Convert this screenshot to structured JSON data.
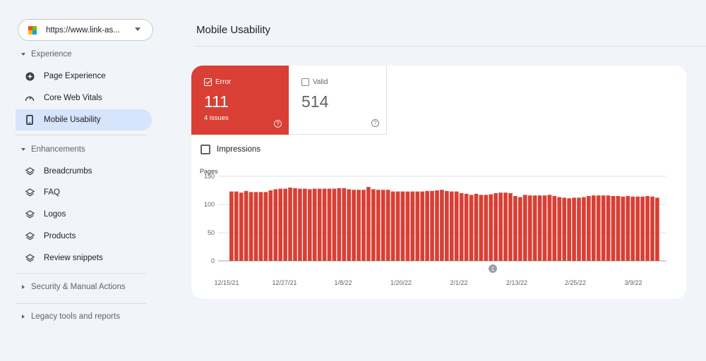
{
  "property": {
    "url": "https://www.link-as...",
    "icon": "microsoft-logo-icon"
  },
  "sidebar": {
    "experience_label": "Experience",
    "experience_items": [
      {
        "label": "Page Experience",
        "icon": "plus-circle-icon"
      },
      {
        "label": "Core Web Vitals",
        "icon": "speedometer-icon"
      },
      {
        "label": "Mobile Usability",
        "icon": "mobile-icon",
        "active": true
      }
    ],
    "enhancements_label": "Enhancements",
    "enhancement_items": [
      {
        "label": "Breadcrumbs",
        "icon": "layers-icon"
      },
      {
        "label": "FAQ",
        "icon": "layers-icon"
      },
      {
        "label": "Logos",
        "icon": "layers-icon"
      },
      {
        "label": "Products",
        "icon": "layers-icon"
      },
      {
        "label": "Review snippets",
        "icon": "layers-icon"
      }
    ],
    "security_label": "Security & Manual Actions",
    "legacy_label": "Legacy tools and reports"
  },
  "page": {
    "title": "Mobile Usability"
  },
  "summary": {
    "error": {
      "label": "Error",
      "value": "111",
      "sub": "4 issues",
      "checked": true,
      "color": "#d93f34"
    },
    "valid": {
      "label": "Valid",
      "value": "514",
      "checked": false
    }
  },
  "impressions_label": "Impressions",
  "chart_data": {
    "type": "bar",
    "ylabel": "Pages",
    "ylim": [
      0,
      150
    ],
    "yticks": [
      0,
      50,
      100,
      150
    ],
    "xtick_labels": [
      "12/15/21",
      "12/27/21",
      "1/8/22",
      "1/20/22",
      "2/1/22",
      "2/13/22",
      "2/25/22",
      "3/9/22"
    ],
    "annotation": "1",
    "color": "#d93f34",
    "values": [
      123,
      123,
      121,
      124,
      122,
      122,
      122,
      122,
      125,
      127,
      128,
      128,
      130,
      129,
      128,
      128,
      127,
      128,
      128,
      128,
      128,
      128,
      129,
      129,
      127,
      126,
      126,
      126,
      131,
      127,
      126,
      126,
      126,
      123,
      123,
      123,
      123,
      123,
      123,
      123,
      124,
      124,
      125,
      126,
      124,
      123,
      123,
      120,
      119,
      117,
      119,
      117,
      117,
      118,
      120,
      121,
      121,
      120,
      115,
      113,
      117,
      116,
      116,
      116,
      116,
      117,
      115,
      113,
      112,
      111,
      112,
      112,
      113,
      115,
      116,
      116,
      116,
      116,
      115,
      115,
      114,
      115,
      114,
      114,
      114,
      115,
      114,
      112
    ]
  }
}
